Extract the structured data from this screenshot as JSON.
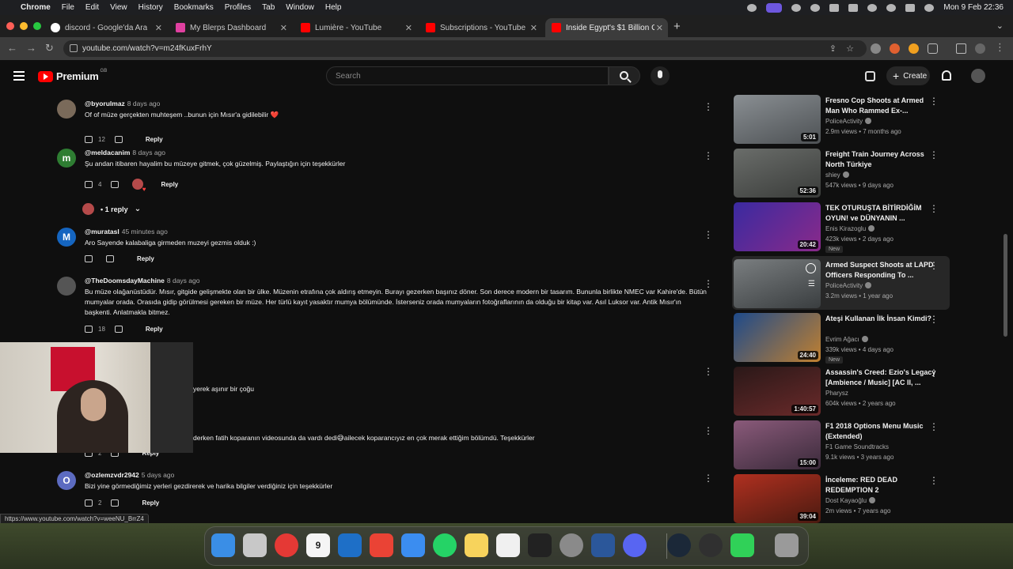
{
  "menubar": {
    "app": "Chrome",
    "items": [
      "File",
      "Edit",
      "View",
      "History",
      "Bookmarks",
      "Profiles",
      "Tab",
      "Window",
      "Help"
    ],
    "clock": "Mon 9 Feb  22:36"
  },
  "tabs": [
    {
      "title": "discord - Google'da Ara",
      "color": "#4285f4"
    },
    {
      "title": "My Blerps Dashboard",
      "color": "#e040a0"
    },
    {
      "title": "Lumière - YouTube",
      "color": "#ff0000"
    },
    {
      "title": "Subscriptions - YouTube",
      "color": "#ff0000"
    },
    {
      "title": "Inside Egypt's $1 Billion Gran",
      "color": "#ff0000"
    }
  ],
  "address": {
    "url": "youtube.com/watch?v=m24fKuxFrhY"
  },
  "header": {
    "brand": "Premium",
    "region": "GB",
    "search_placeholder": "Search",
    "create_label": "Create"
  },
  "comments": [
    {
      "handle": "@byorulmaz",
      "when": "8 days ago",
      "text": "Of of müze gerçekten muhteşem ..bunun için Mısır'a  gidilebilir ❤️",
      "likes": "12",
      "reply": "Reply",
      "avatar_color": "#7a6a5a",
      "avatar_letter": ""
    },
    {
      "handle": "@meldacanim",
      "when": "8 days ago",
      "text": "Şu andan itibaren hayalim bu müzeye gitmek, çok güzelmiş. Paylaştığın için teşekkürler",
      "likes": "4",
      "reply": "Reply",
      "avatar_color": "#2e7d32",
      "avatar_letter": "m"
    },
    {
      "handle": "@muratasl",
      "when": "45 minutes ago",
      "text": "Aro Sayende kalabaliga girmeden muzeyi gezmis olduk :)",
      "likes": "",
      "reply": "Reply",
      "avatar_color": "#1565c0",
      "avatar_letter": "M"
    },
    {
      "handle": "@TheDoomsdayMachine",
      "when": "8 days ago",
      "text": "Bu müze olağanüstüdür. Mısır, gitgide gelişmekte olan bir ülke. Müzenin etrafına çok aldırış etmeyin. Burayı gezerken başınız döner. Son derece modern bir tasarım. Bununla birlikte NMEC var Kahire'de. Bütün mumyalar orada. Orasıda gidip görülmesi gereken bir müze. Her türlü kayıt yasaktır mumya bölümünde. İsterseniz orada mumyaların fotoğraflarının da olduğu bir kitap var. Asıl Luksor var. Antik Mısır'ın başkenti. Anlatmakla bitmez.",
      "likes": "18",
      "reply": "Reply",
      "avatar_color": "#555555",
      "avatar_letter": ""
    },
    {
      "handle": "",
      "when": "",
      "text": "yerek aşınır bir çoğu",
      "likes": "",
      "reply": "",
      "avatar_color": "",
      "avatar_letter": ""
    },
    {
      "handle": "",
      "when": "",
      "text": "derken fatih koparanın videosunda da vardı dedi😅ailecek koparancıyız en çok merak ettiğim bölümdü. Teşekkürler",
      "likes": "2",
      "reply": "Reply",
      "avatar_color": "",
      "avatar_letter": ""
    },
    {
      "handle": "@ozlemzvdr2942",
      "when": "5 days ago",
      "text": "Bizi yine görmediğimiz yerleri gezdirerek ve harika bilgiler verdiğiniz için teşekkürler",
      "likes": "2",
      "reply": "Reply",
      "avatar_color": "#5c6bc0",
      "avatar_letter": "O"
    }
  ],
  "replies_toggle": "1 reply",
  "sidebar": [
    {
      "title": "Fresno Cop Shoots at Armed Man Who Rammed Ex-...",
      "channel": "PoliceActivity",
      "stats": "2.9m views • 7 months ago",
      "duration": "5:01",
      "badge": "",
      "thumb": "#6b6f72"
    },
    {
      "title": "Freight Train Journey Across North Türkiye",
      "channel": "shiey",
      "stats": "547k views • 9 days ago",
      "duration": "52:36",
      "badge": "",
      "thumb": "#5a5c5a"
    },
    {
      "title": "TEK OTURUŞTA BİTİRDİĞİM OYUN! ve DÜNYANIN ...",
      "channel": "Enis Kirazoglu",
      "stats": "423k views • 2 days ago",
      "duration": "20:42",
      "badge": "New",
      "thumb": "#4a2d8a"
    },
    {
      "title": "Armed Suspect Shoots at LAPD Officers Responding To ...",
      "channel": "PoliceActivity",
      "stats": "3.2m views • 1 year ago",
      "duration": "",
      "badge": "",
      "thumb": "#555a5c"
    },
    {
      "title": "Ateşi Kullanan İlk İnsan Kimdi?",
      "channel": "Evrim Ağacı",
      "stats": "339k views • 4 days ago",
      "duration": "24:40",
      "badge": "New",
      "thumb": "#2a4a7a"
    },
    {
      "title": "Assassin's Creed: Ezio's Legacy [Ambience / Music] [AC II, ...",
      "channel": "Pharysz",
      "stats": "604k views • 2 years ago",
      "duration": "1:40:57",
      "badge": "",
      "thumb": "#3a2020"
    },
    {
      "title": "F1 2018 Options Menu Music (Extended)",
      "channel": "F1 Game Soundtracks",
      "stats": "9.1k views • 3 years ago",
      "duration": "15:00",
      "badge": "",
      "thumb": "#6a3a5a"
    },
    {
      "title": "İnceleme: RED DEAD REDEMPTION 2",
      "channel": "Dost Kayaoğlu",
      "stats": "2m views • 7 years ago",
      "duration": "39:04",
      "badge": "",
      "thumb": "#8a2a20"
    }
  ],
  "statusbar": "https://www.youtube.com/watch?v=weeNU_BrrZ4",
  "dock": [
    {
      "name": "finder",
      "color": "#3a8ee6",
      "label": ""
    },
    {
      "name": "launchpad",
      "color": "#d0d0d0",
      "label": ""
    },
    {
      "name": "chrome",
      "color": "#e53935",
      "label": ""
    },
    {
      "name": "calendar",
      "color": "#f5f5f5",
      "label": "9"
    },
    {
      "name": "outlook",
      "color": "#1e6fc7",
      "label": ""
    },
    {
      "name": "gmail",
      "color": "#ea4335",
      "label": ""
    },
    {
      "name": "mail",
      "color": "#3b8df0",
      "label": ""
    },
    {
      "name": "whatsapp",
      "color": "#25d366",
      "label": ""
    },
    {
      "name": "notes",
      "color": "#f7d35c",
      "label": ""
    },
    {
      "name": "reminders",
      "color": "#f0f0f0",
      "label": ""
    },
    {
      "name": "capcut",
      "color": "#222222",
      "label": ""
    },
    {
      "name": "settings",
      "color": "#8a8a8a",
      "label": ""
    },
    {
      "name": "word",
      "color": "#2b579a",
      "label": ""
    },
    {
      "name": "discord",
      "color": "#5865f2",
      "label": ""
    },
    {
      "name": "steam",
      "color": "#1b2838",
      "label": ""
    },
    {
      "name": "obs",
      "color": "#303030",
      "label": ""
    },
    {
      "name": "phone",
      "color": "#30d158",
      "label": ""
    },
    {
      "name": "trash",
      "color": "#9a9a9a",
      "label": ""
    }
  ]
}
